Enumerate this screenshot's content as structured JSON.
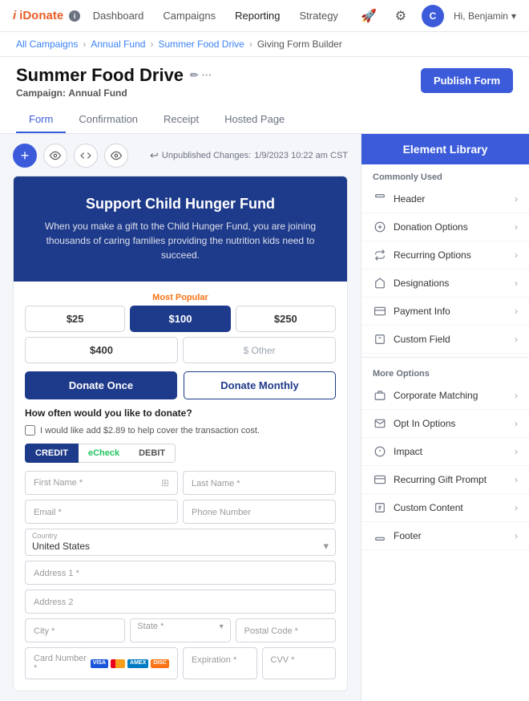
{
  "nav": {
    "logo": "iDonate",
    "links": [
      "Dashboard",
      "Campaigns",
      "Reporting",
      "Strategy"
    ],
    "active_link": "Campaigns",
    "user": "Hi, Benjamin"
  },
  "breadcrumb": {
    "items": [
      "All Campaigns",
      "Annual Fund",
      "Summer Food Drive"
    ],
    "current": "Giving Form Builder"
  },
  "page": {
    "title": "Summer Food Drive",
    "subtitle_label": "Campaign:",
    "subtitle_value": "Annual Fund",
    "publish_btn": "Publish Form"
  },
  "tabs": [
    "Form",
    "Confirmation",
    "Receipt",
    "Hosted Page"
  ],
  "active_tab": "Form",
  "toolbar": {
    "unpublished": "Unpublished Changes:",
    "date": "1/9/2023 10:22 am CST"
  },
  "form_preview": {
    "hero_title": "Support Child Hunger Fund",
    "hero_body": "When you make a gift to the Child Hunger Fund, you are joining thousands of caring families providing the nutrition kids need to succeed.",
    "most_popular": "Most Popular",
    "amounts": [
      "$25",
      "$100",
      "$250"
    ],
    "amounts_row2": [
      "$400",
      "$ Other"
    ],
    "selected_amount": "$100",
    "donate_once": "Donate Once",
    "donate_monthly": "Donate Monthly",
    "frequency_question": "How often would you like to donate?",
    "checkbox_text": "I would like add $2.89 to help cover the transaction cost.",
    "payment_tabs": [
      "CREDIT",
      "eCheck",
      "DEBIT"
    ],
    "active_payment": "CREDIT",
    "fields": {
      "first_name": "First Name *",
      "last_name": "Last Name *",
      "email": "Email *",
      "phone": "Phone Number",
      "country": "United States",
      "address1": "Address 1 *",
      "address2": "Address 2",
      "city": "City *",
      "state": "State *",
      "postal": "Postal Code *",
      "card_number": "Card Number *",
      "expiration": "Expiration *",
      "cvv": "CVV *"
    }
  },
  "element_library": {
    "title": "Element Library",
    "commonly_used_label": "Commonly Used",
    "commonly_used": [
      {
        "label": "Header",
        "icon": "header"
      },
      {
        "label": "Donation Options",
        "icon": "dollar"
      },
      {
        "label": "Recurring Options",
        "icon": "recurring"
      },
      {
        "label": "Designations",
        "icon": "home"
      },
      {
        "label": "Payment Info",
        "icon": "payment"
      },
      {
        "label": "Custom Field",
        "icon": "field"
      }
    ],
    "more_options_label": "More Options",
    "more_options": [
      {
        "label": "Corporate Matching",
        "icon": "building"
      },
      {
        "label": "Opt In Options",
        "icon": "email"
      },
      {
        "label": "Impact",
        "icon": "impact"
      },
      {
        "label": "Recurring Gift Prompt",
        "icon": "gift"
      },
      {
        "label": "Custom Content",
        "icon": "content"
      },
      {
        "label": "Footer",
        "icon": "footer"
      }
    ]
  }
}
